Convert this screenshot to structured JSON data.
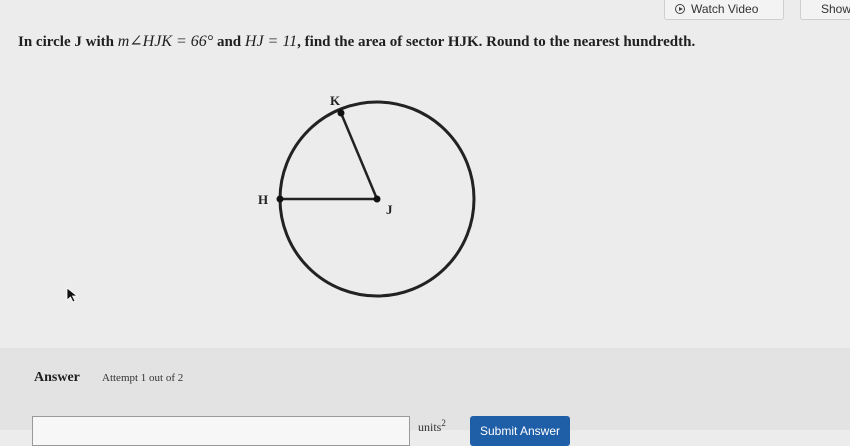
{
  "toolbar": {
    "watch_video_label": "Watch Video",
    "show_label": "Show"
  },
  "question": {
    "prefix": "In circle J with ",
    "angle_expr": "m∠HJK = 66°",
    "middle": " and ",
    "length_expr": "HJ = 11",
    "suffix": ", find the area of sector HJK. Round to the nearest hundredth."
  },
  "figure": {
    "label_k": "K",
    "label_h": "H",
    "label_j": "J"
  },
  "answer": {
    "label": "Answer",
    "attempt": "Attempt 1 out of 2",
    "input_value": "",
    "units_base": "units",
    "units_exp": "2",
    "submit_label": "Submit Answer"
  },
  "icons": [
    "play-circle-icon",
    "mouse-cursor-icon"
  ]
}
